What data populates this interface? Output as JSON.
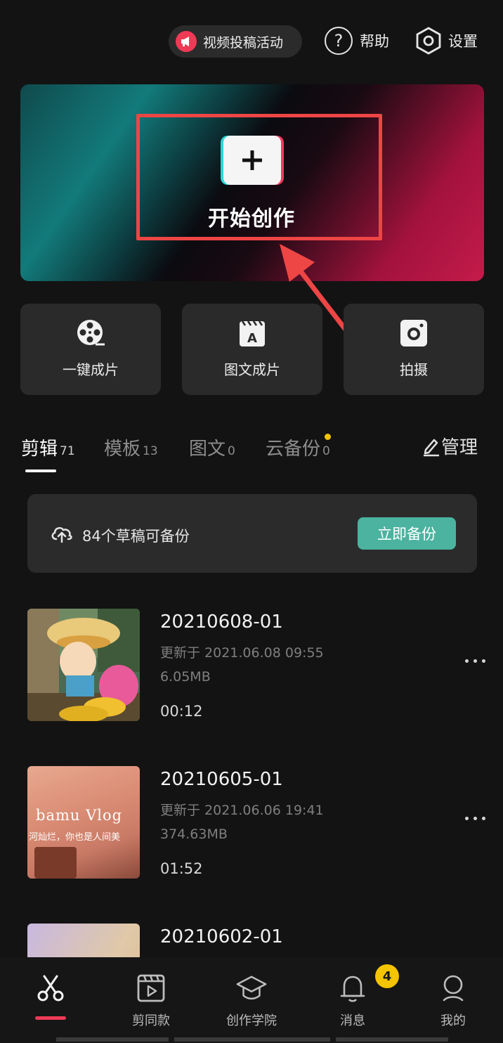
{
  "header": {
    "promo_label": "视频投稿活动",
    "help_label": "帮助",
    "settings_label": "设置"
  },
  "hero": {
    "title": "开始创作"
  },
  "quick_actions": [
    {
      "label": "一键成片",
      "icon": "film-reel-icon"
    },
    {
      "label": "图文成片",
      "icon": "text-to-video-icon"
    },
    {
      "label": "拍摄",
      "icon": "camera-icon"
    }
  ],
  "tabs": [
    {
      "label": "剪辑",
      "count": "71",
      "active": true
    },
    {
      "label": "模板",
      "count": "13",
      "active": false
    },
    {
      "label": "图文",
      "count": "0",
      "active": false
    },
    {
      "label": "云备份",
      "count": "0",
      "active": false
    }
  ],
  "manage_label": "管理",
  "backup": {
    "text": "84个草稿可备份",
    "button_label": "立即备份"
  },
  "drafts": [
    {
      "title": "20210608-01",
      "updated": "更新于 2021.06.08 09:55",
      "size": "6.05MB",
      "duration": "00:12"
    },
    {
      "title": "20210605-01",
      "updated": "更新于 2021.06.06 19:41",
      "size": "374.63MB",
      "duration": "01:52",
      "thumb_text_1": "bamu Vlog",
      "thumb_text_2": "河灿烂，你也是人间美"
    },
    {
      "title": "20210602-01"
    }
  ],
  "bottom_nav": [
    {
      "label": "",
      "icon": "scissors-icon",
      "active": true
    },
    {
      "label": "剪同款",
      "icon": "template-icon"
    },
    {
      "label": "创作学院",
      "icon": "graduation-cap-icon"
    },
    {
      "label": "消息",
      "icon": "bell-icon",
      "badge": "4"
    },
    {
      "label": "我的",
      "icon": "person-icon"
    }
  ],
  "colors": {
    "accent_red": "#ef3a56",
    "teal_button": "#4bb3a0",
    "badge_yellow": "#f4c400",
    "annotation_red": "#ee4545"
  }
}
